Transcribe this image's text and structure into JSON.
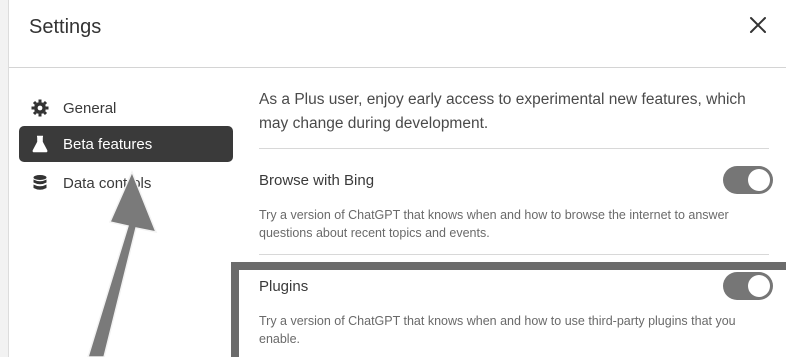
{
  "header": {
    "title": "Settings",
    "close_icon": "close-icon"
  },
  "sidebar": {
    "items": [
      {
        "label": "General",
        "icon": "gear-icon",
        "active": false
      },
      {
        "label": "Beta features",
        "icon": "flask-icon",
        "active": true
      },
      {
        "label": "Data controls",
        "icon": "database-icon",
        "active": false
      }
    ]
  },
  "main": {
    "intro": "As a Plus user, enjoy early access to experimental new features, which may change during development.",
    "features": [
      {
        "name": "Browse with Bing",
        "description": "Try a version of ChatGPT that knows when and how to browse the internet to answer questions about recent topics and events.",
        "enabled": true
      },
      {
        "name": "Plugins",
        "description": "Try a version of ChatGPT that knows when and how to use third-party plugins that you enable.",
        "enabled": true
      }
    ]
  },
  "colors": {
    "active_nav": "#3a3a3a",
    "toggle_on": "#767676",
    "annotation": "#6b6b6b"
  }
}
